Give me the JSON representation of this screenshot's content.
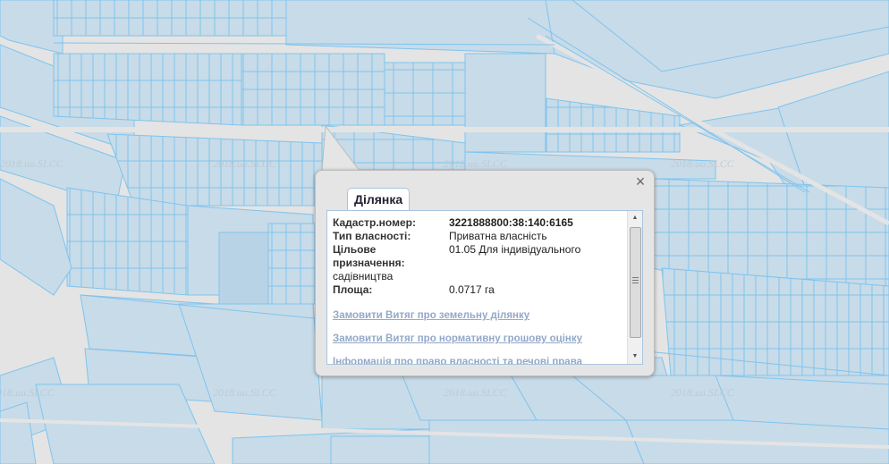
{
  "map": {
    "watermark": "2018.ua.SLCC",
    "parcel_fill": "#c8dbe8",
    "parcel_stroke": "#7ec4ee",
    "road_color": "#e4e4e4"
  },
  "popup": {
    "tab_label": "Ділянка",
    "close_icon": "×",
    "fields": [
      {
        "label": "Кадастр.номер:",
        "value": "3221888800:38:140:6165",
        "bold": true
      },
      {
        "label": "Тип власності:",
        "value": "Приватна власність"
      },
      {
        "label": "Цільове призначення:",
        "value": "01.05 Для індивідуального",
        "continuation": "садівництва"
      },
      {
        "label": "Площа:",
        "value": "0.0717 га"
      }
    ],
    "links": [
      "Замовити Витяг про земельну ділянку",
      "Замовити Витяг про нормативну грошову оцінку",
      "Інформація про право власності та речові права"
    ],
    "scroll_up_icon": "▲",
    "scroll_down_icon": "▼"
  }
}
